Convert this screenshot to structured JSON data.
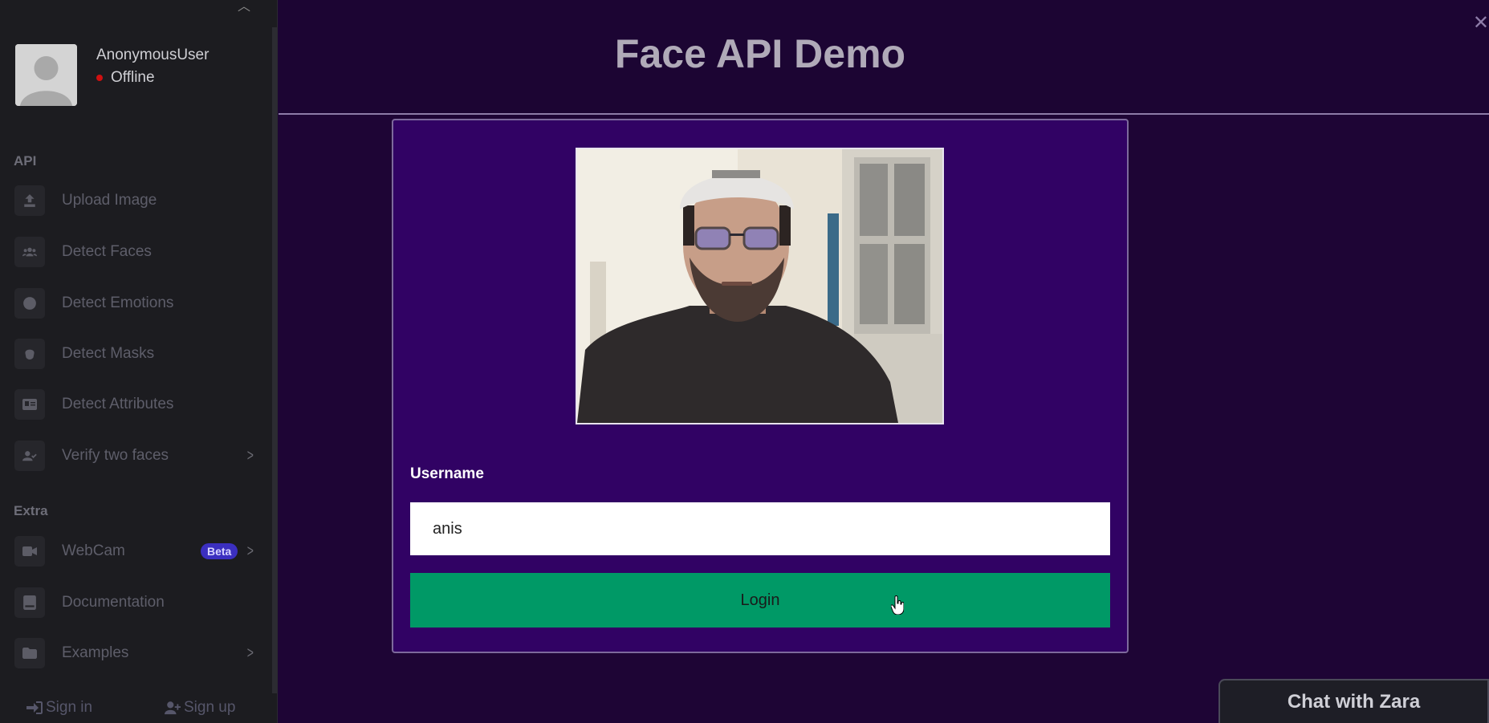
{
  "sidebar": {
    "user": {
      "name": "AnonymousUser",
      "status": "Offline"
    },
    "sections": {
      "api": "API",
      "extra": "Extra"
    },
    "items": [
      {
        "label": "Upload Image",
        "icon": "upload-icon"
      },
      {
        "label": "Detect Faces",
        "icon": "users-icon"
      },
      {
        "label": "Detect Emotions",
        "icon": "emotion-icon"
      },
      {
        "label": "Detect Masks",
        "icon": "mask-icon"
      },
      {
        "label": "Detect Attributes",
        "icon": "id-card-icon"
      },
      {
        "label": "Verify two faces",
        "icon": "user-check-icon"
      },
      {
        "label": "WebCam",
        "icon": "video-icon",
        "badge": "Beta"
      },
      {
        "label": "Documentation",
        "icon": "book-icon"
      },
      {
        "label": "Examples",
        "icon": "folder-icon"
      }
    ],
    "auth": {
      "sign_in": "Sign in",
      "sign_up": "Sign up"
    }
  },
  "main": {
    "title": "Face API Demo",
    "form": {
      "username_label": "Username",
      "username_value": "anis",
      "login_label": "Login"
    },
    "chat": {
      "label": "Chat with Zara"
    }
  },
  "colors": {
    "sidebar_bg": "#1c1c20",
    "main_bg": "#1e0535",
    "card_bg": "#310264",
    "login_button": "#009966",
    "beta_badge": "#3b2fc0",
    "status_offline": "#d01010"
  }
}
